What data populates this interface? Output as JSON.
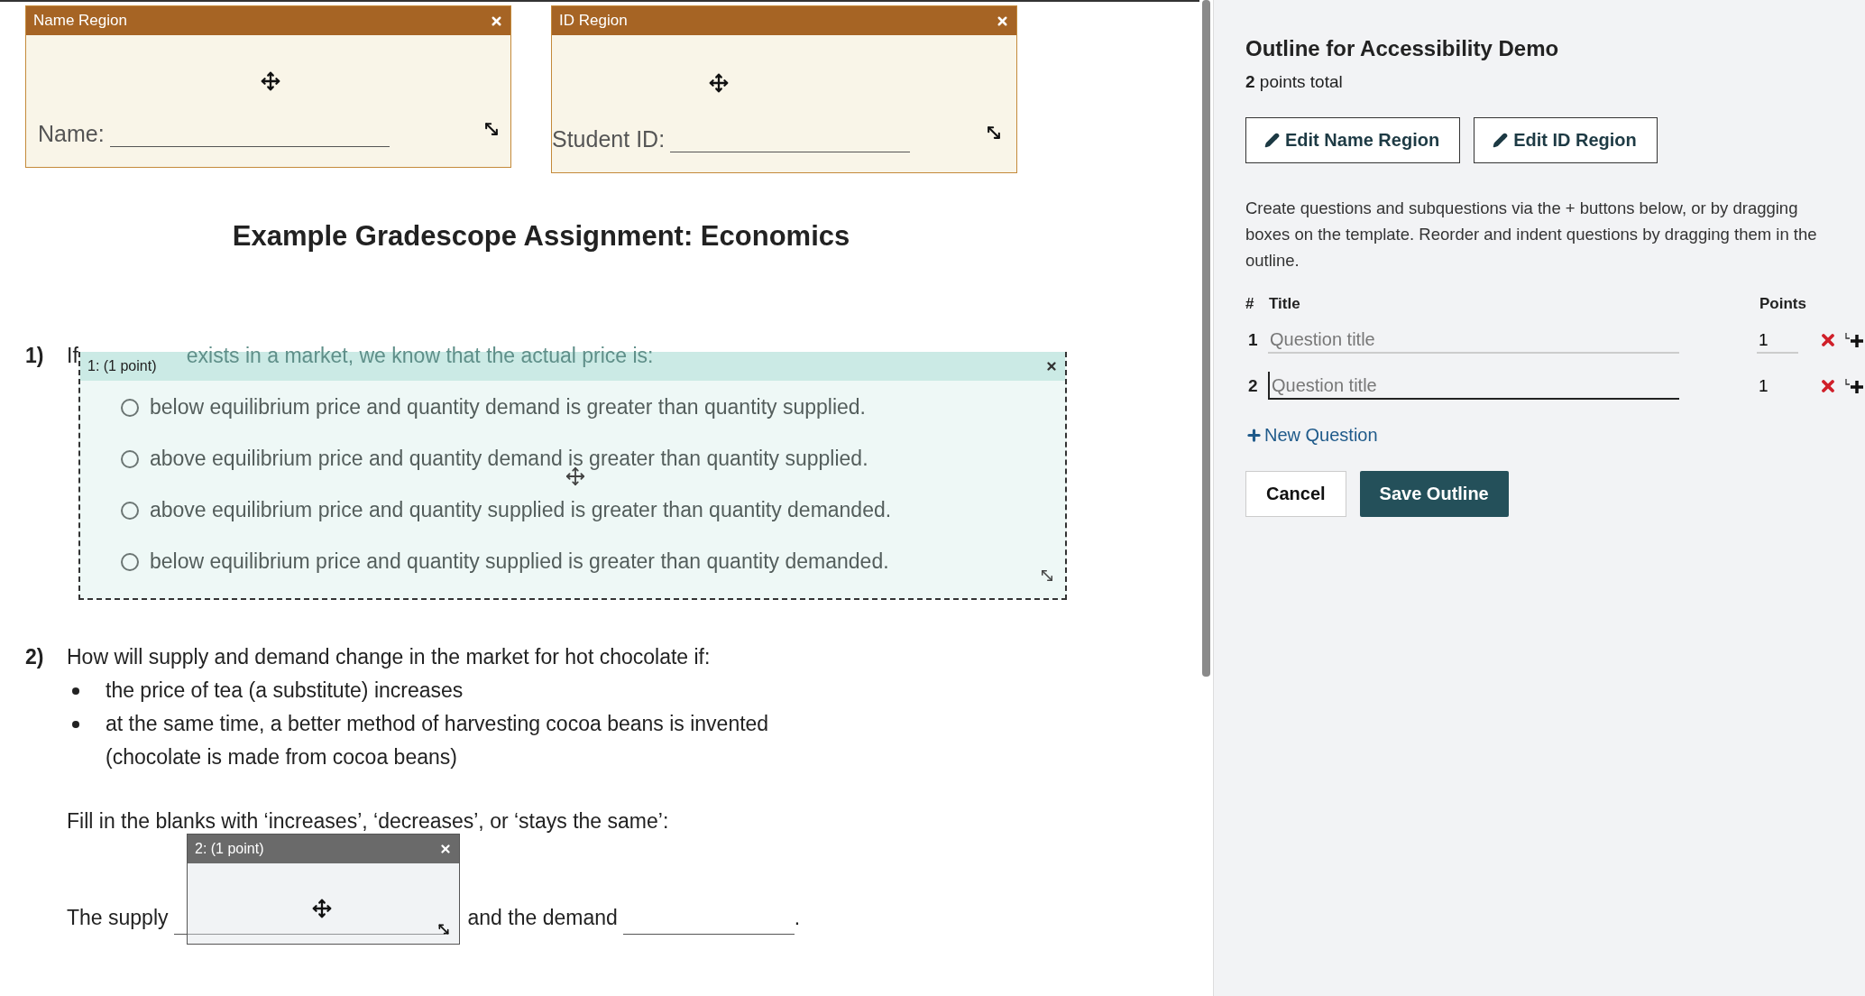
{
  "regions": [
    {
      "title": "Name Region",
      "label": "Name:"
    },
    {
      "title": "ID Region",
      "label": "Student ID:"
    }
  ],
  "document": {
    "title": "Example Gradescope Assignment: Economics",
    "question_1": {
      "number": "1)",
      "prompt_start": "If",
      "prompt_rest": "exists in a market, we know that the actual price is:",
      "box_label": "1: (1 point)",
      "options": [
        {
          "text": "below equilibrium price and quantity demand is greater than quantity supplied.",
          "selected": false
        },
        {
          "text": "above equilibrium price and quantity demand is greater than quantity supplied.",
          "selected": false
        },
        {
          "text": "above equilibrium price and quantity supplied is greater than quantity demanded.",
          "selected": false
        },
        {
          "text": "below equilibrium price and quantity supplied is greater than quantity demanded.",
          "selected": false
        }
      ]
    },
    "question_2": {
      "number": "2)",
      "prompt": "How will supply and demand change in the market for hot chocolate if:",
      "bullets": [
        "the price of tea (a substitute) increases",
        "at the same time, a better method of harvesting cocoa beans is invented (chocolate is made from cocoa beans)"
      ],
      "instruction": "Fill in the blanks with ‘increases’, ‘decreases’, or ‘stays the same’:",
      "blank_before": "The supply",
      "blank_middle": "and the demand",
      "blank_end": ".",
      "box_label": "2: (1 point)"
    }
  },
  "outline": {
    "title": "Outline for Accessibility Demo",
    "total": "2",
    "total_label": "points total",
    "edit_buttons": [
      "Edit Name Region",
      "Edit ID Region"
    ],
    "help": "Create questions and subquestions via the + buttons below, or by dragging boxes on the template. Reorder and indent questions by dragging them in the outline.",
    "columns": {
      "number": "#",
      "title": "Title",
      "points": "Points"
    },
    "questions": [
      {
        "number": "1",
        "placeholder": "Question title",
        "points": "1",
        "focused": false
      },
      {
        "number": "2",
        "placeholder": "Question title",
        "points": "1",
        "focused": true
      }
    ],
    "new_question": "New Question",
    "cancel": "Cancel",
    "save": "Save Outline"
  }
}
